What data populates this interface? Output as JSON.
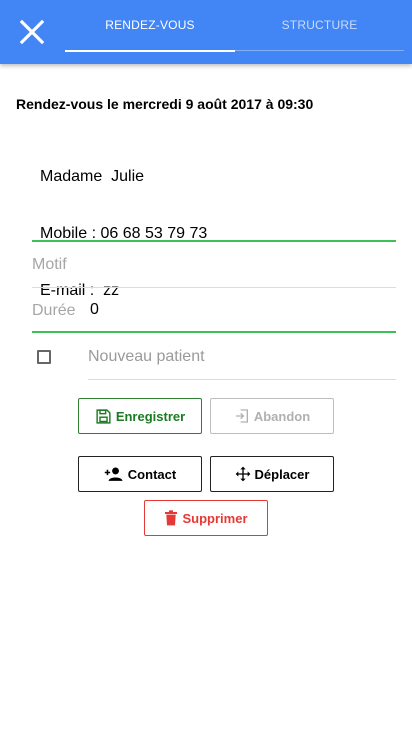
{
  "header": {
    "tabs": [
      {
        "label": "RENDEZ-VOUS",
        "active": true
      },
      {
        "label": "STRUCTURE",
        "active": false
      }
    ],
    "close_icon": "close-icon",
    "accent_color": "#4285f4"
  },
  "appointment": {
    "title": "Rendez-vous le mercredi 9 août 2017 à 09:30",
    "patient_line": "Madame  Julie",
    "mobile_line": "Mobile : 06 68 53 79 73",
    "email_line": "E-mail :  zz"
  },
  "form": {
    "motif_label": "Motif",
    "motif_value": "",
    "duree_label": "Durée",
    "duree_value": "0",
    "new_patient_label": "Nouveau patient",
    "new_patient_checked": false
  },
  "buttons": {
    "save": "Enregistrer",
    "abort": "Abandon",
    "contact": "Contact",
    "move": "Déplacer",
    "delete": "Supprimer"
  },
  "colors": {
    "save": "#1b7b22",
    "abort": "#b0b0b0",
    "delete": "#e53935",
    "focus_line": "#3dbf5a"
  }
}
